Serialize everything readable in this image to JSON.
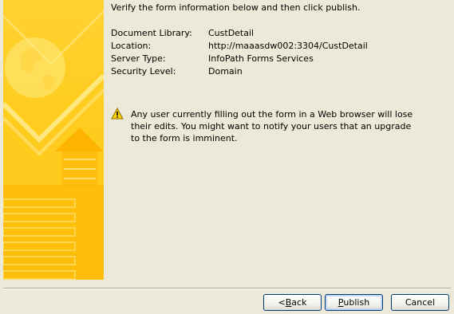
{
  "intro": "Verify the form information below and then click publish.",
  "details": [
    {
      "label": "Document Library:",
      "value": "CustDetail"
    },
    {
      "label": "Location:",
      "value": "http://maaasdw002:3304/CustDetail"
    },
    {
      "label": "Server Type:",
      "value": "InfoPath Forms Services"
    },
    {
      "label": "Security Level:",
      "value": "Domain"
    }
  ],
  "warning": {
    "icon": "warning-icon",
    "text": "Any user currently filling out the form in a Web browser will lose their edits. You might want to notify your users that an upgrade to the form is imminent."
  },
  "buttons": {
    "back_prefix": "< ",
    "back_mnemonic": "B",
    "back_rest": "ack",
    "publish_mnemonic": "P",
    "publish_rest": "ublish",
    "cancel": "Cancel"
  },
  "colors": {
    "background": "#ece9d8",
    "art": "#ffcd1f",
    "button_border": "#003c74"
  }
}
